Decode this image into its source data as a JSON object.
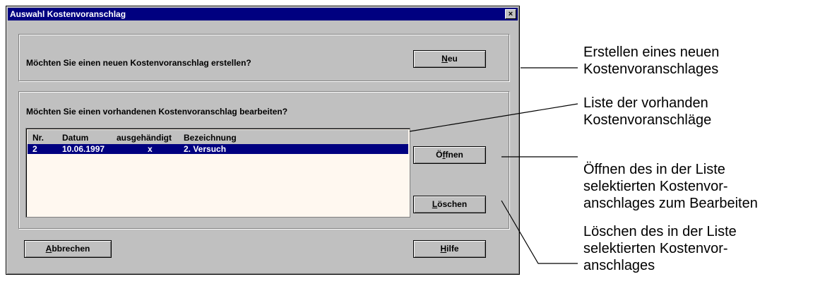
{
  "dialog": {
    "title": "Auswahl Kostenvoranschlag",
    "close_glyph": "×",
    "new_question": "Möchten Sie einen neuen Kostenvoranschlag erstellen?",
    "edit_question": "Möchten Sie einen vorhandenen Kostenvoranschlag bearbeiten?",
    "buttons": {
      "new": {
        "mnemonic": "N",
        "rest": "eu"
      },
      "open": {
        "pre": "Ö",
        "mnemonic": "f",
        "rest": "fnen"
      },
      "delete": {
        "mnemonic": "L",
        "rest": "öschen"
      },
      "cancel": {
        "mnemonic": "A",
        "rest": "bbrechen"
      },
      "help": {
        "mnemonic": "H",
        "rest": "ilfe"
      }
    },
    "list": {
      "columns": [
        "Nr.",
        "Datum",
        "ausgehändigt",
        "Bezeichnung"
      ],
      "rows": [
        {
          "nr": "2",
          "datum": "10.06.1997",
          "ausgehaendigt": "x",
          "bezeichnung": "2. Versuch",
          "selected": true
        }
      ]
    }
  },
  "annotations": {
    "new": [
      "Erstellen eines neuen",
      "Kostenvoranschlages"
    ],
    "list": [
      "Liste der vorhanden",
      "Kostenvoranschläge"
    ],
    "open": [
      "Öffnen des in der Liste",
      "selektierten Kostenvor-",
      "anschlages zum Bearbeiten"
    ],
    "delete": [
      "Löschen des in der Liste",
      "selektierten Kostenvor-",
      "anschlages"
    ]
  },
  "colors": {
    "titlebar": "#000080",
    "dialog_bg": "#c0c0c0",
    "selection": "#000080",
    "list_bg": "#fff8f0"
  }
}
